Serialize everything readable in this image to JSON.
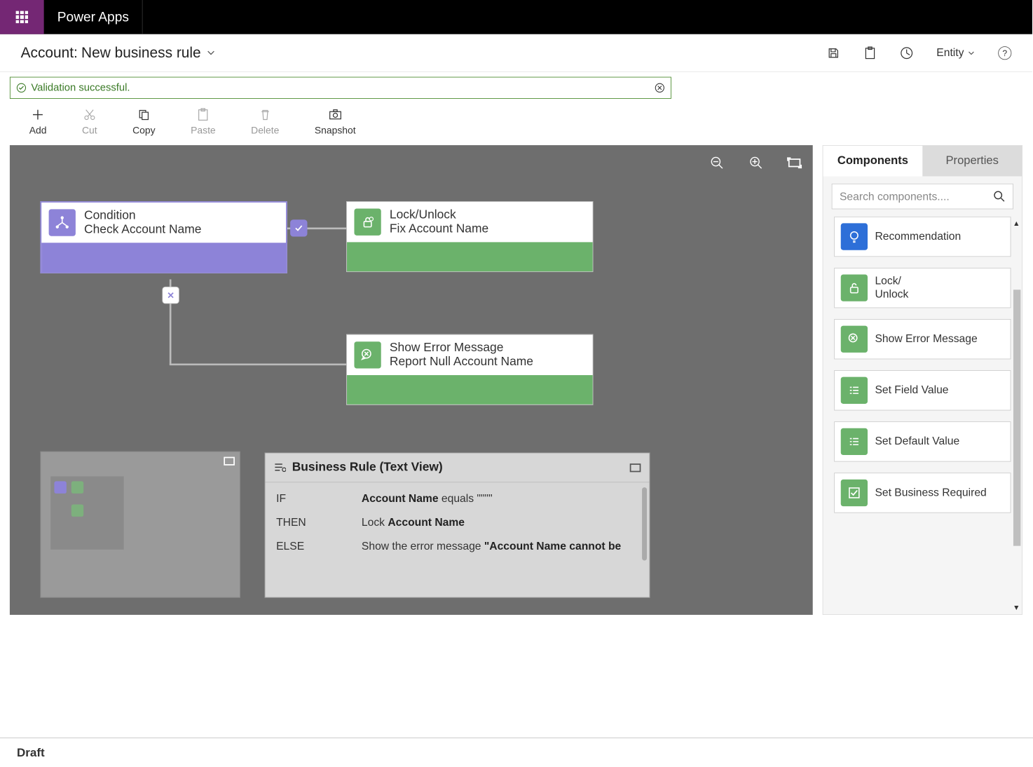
{
  "topbar": {
    "app_title": "Power Apps"
  },
  "header": {
    "entity": "Account:",
    "rule_name": "New business rule",
    "scope_label": "Entity"
  },
  "validation": {
    "message": "Validation successful."
  },
  "toolbar": {
    "add": "Add",
    "cut": "Cut",
    "copy": "Copy",
    "paste": "Paste",
    "delete": "Delete",
    "snapshot": "Snapshot"
  },
  "nodes": {
    "condition": {
      "type": "Condition",
      "title": "Check Account Name"
    },
    "lock": {
      "type": "Lock/Unlock",
      "title": "Fix Account Name"
    },
    "error": {
      "type": "Show Error Message",
      "title": "Report Null Account Name"
    }
  },
  "textview": {
    "title": "Business Rule (Text View)",
    "if_kw": "IF",
    "then_kw": "THEN",
    "else_kw": "ELSE",
    "if_field": "Account Name",
    "if_rest": " equals \"\"\"\"",
    "then_pre": "Lock ",
    "then_field": "Account Name",
    "else_pre": "Show the error message ",
    "else_msg": "\"Account Name cannot be"
  },
  "rpanel": {
    "tab_components": "Components",
    "tab_properties": "Properties",
    "search_placeholder": "Search components....",
    "items": {
      "recommendation": "Recommendation",
      "lock": "Lock/\nUnlock",
      "error": "Show Error Message",
      "setfield": "Set Field Value",
      "setdefault": "Set Default Value",
      "setreq": "Set Business Required"
    }
  },
  "footer": {
    "status": "Draft"
  }
}
